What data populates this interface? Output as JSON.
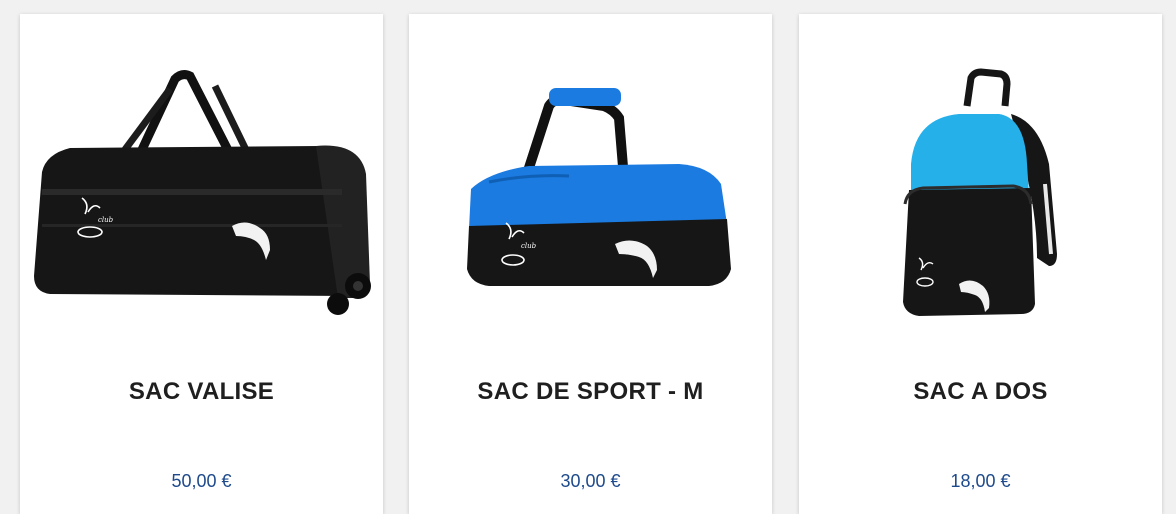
{
  "products": [
    {
      "name": "SAC VALISE",
      "price": "50,00 €",
      "image_icon": "rolling-duffel-bag-icon"
    },
    {
      "name": "SAC DE SPORT - M",
      "price": "30,00 €",
      "image_icon": "sport-duffel-bag-icon"
    },
    {
      "name": "SAC A DOS",
      "price": "18,00 €",
      "image_icon": "backpack-icon"
    }
  ],
  "colors": {
    "bag_black": "#161616",
    "bag_blue": "#1b7be0",
    "backpack_blue": "#25b0ea",
    "price": "#1e4a8c",
    "title": "#1f1f1f"
  }
}
